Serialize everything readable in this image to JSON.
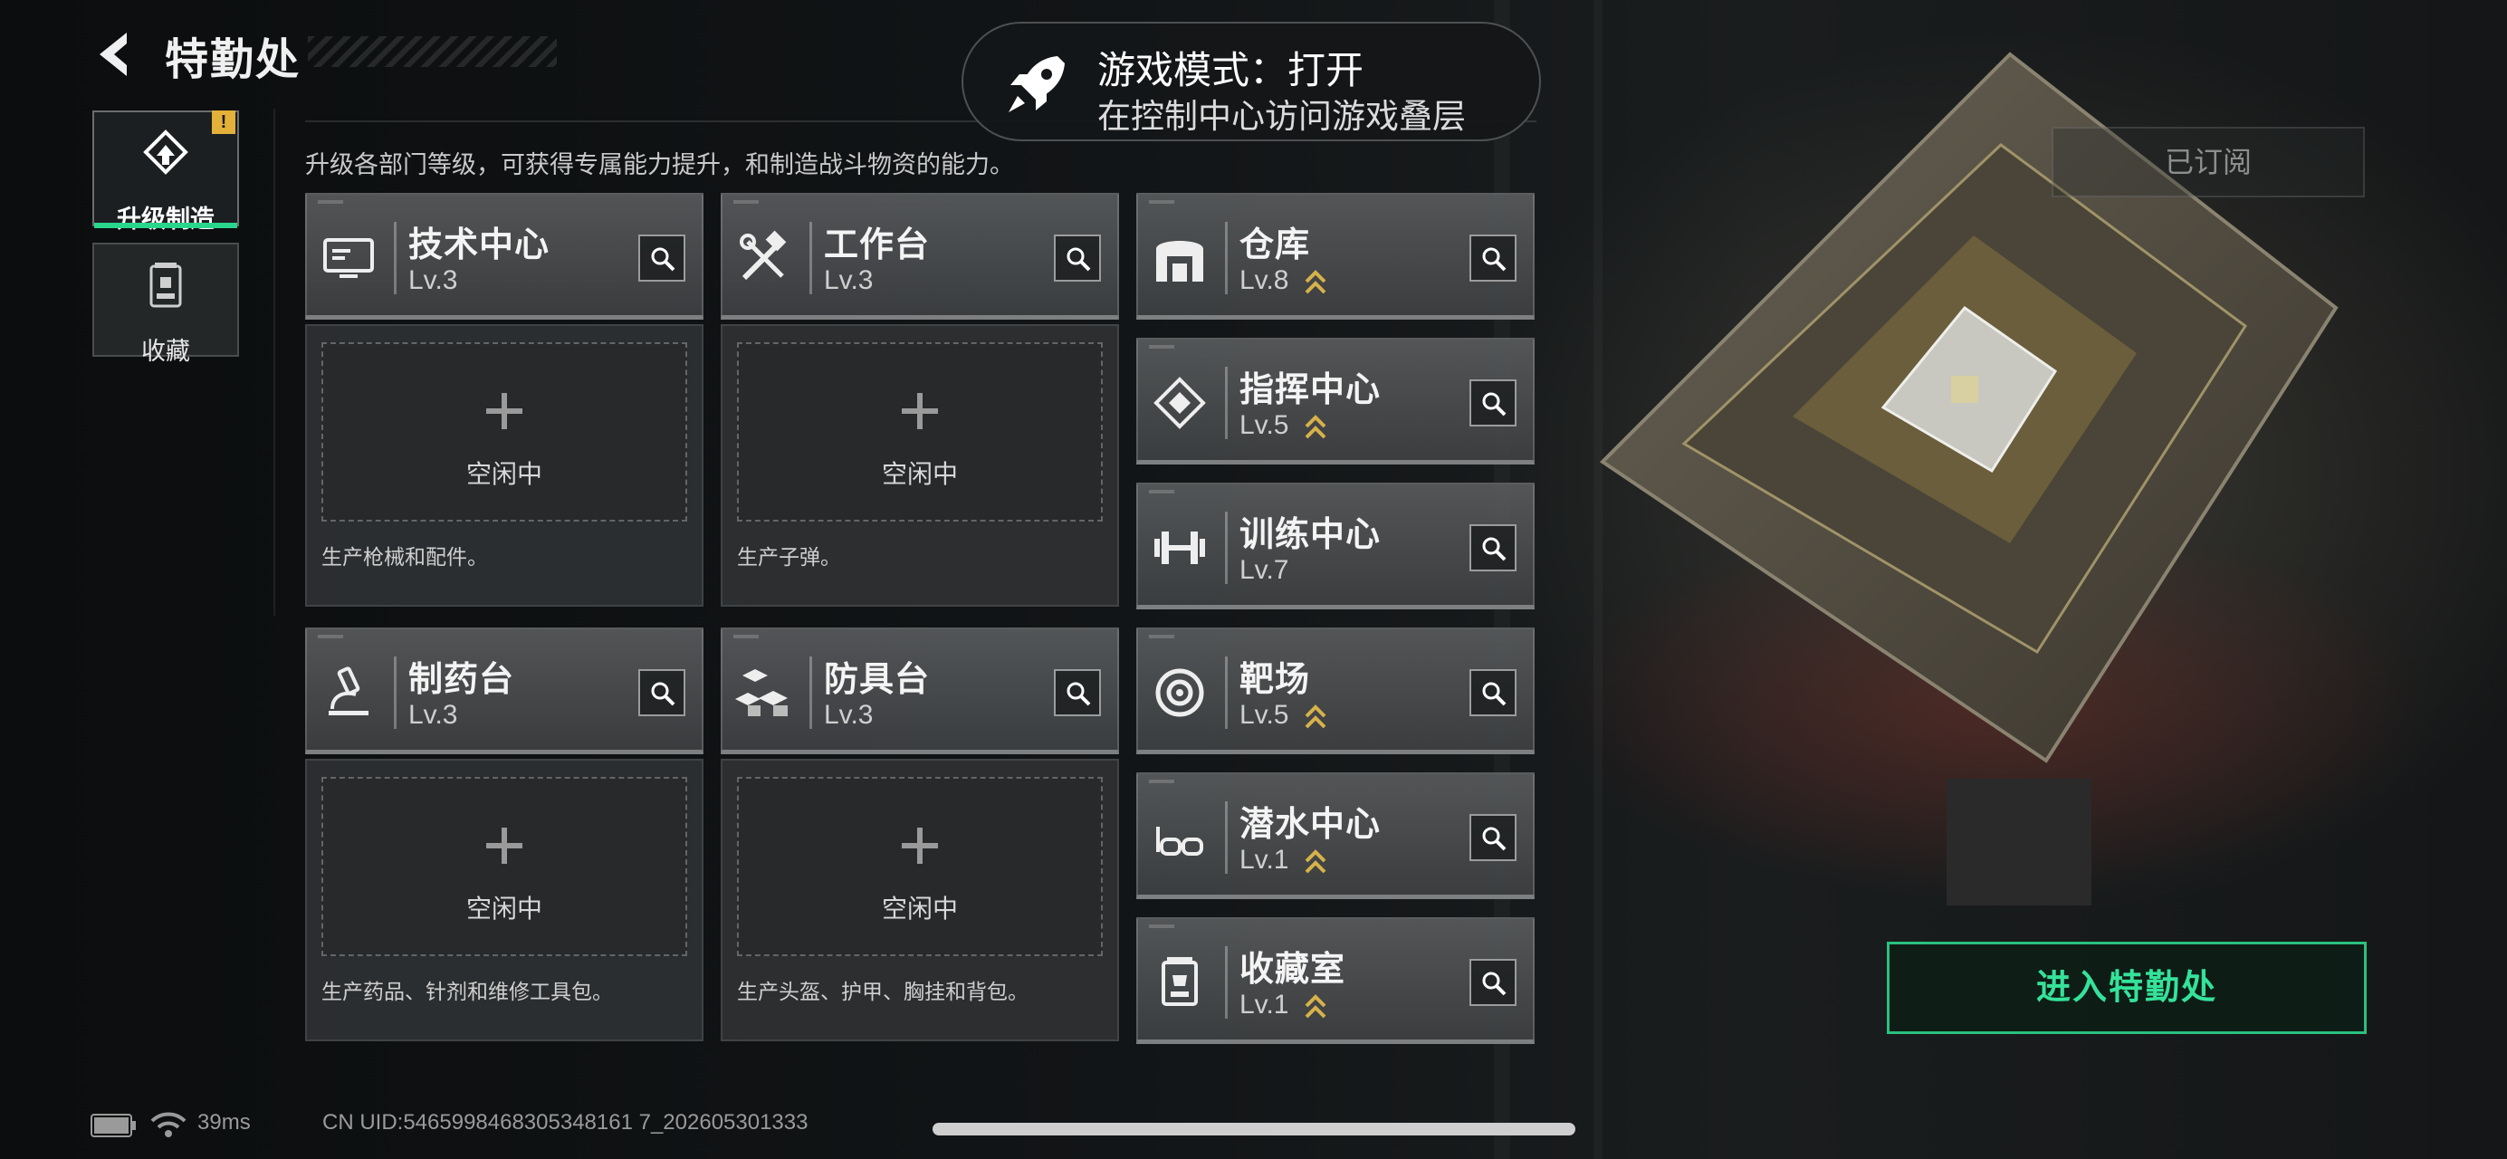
{
  "header": {
    "title": "特勤处"
  },
  "subtitle": "升级各部门等级，可获得专属能力提升，和制造战斗物资的能力。",
  "sidebar": {
    "items": [
      {
        "label": "升级制造",
        "active": true,
        "badge": "!"
      },
      {
        "label": "收藏",
        "active": false
      }
    ]
  },
  "toast": {
    "title": "游戏模式：打开",
    "subtitle": "在控制中心访问游戏叠层",
    "icon": "rocket-icon"
  },
  "production": [
    {
      "name": "技术中心",
      "level": "Lv.3",
      "icon": "computer-icon",
      "status": "空闲中",
      "desc": "生产枪械和配件。"
    },
    {
      "name": "工作台",
      "level": "Lv.3",
      "icon": "tools-icon",
      "status": "空闲中",
      "desc": "生产子弹。"
    },
    {
      "name": "制药台",
      "level": "Lv.3",
      "icon": "microscope-icon",
      "status": "空闲中",
      "desc": "生产药品、针剂和维修工具包。"
    },
    {
      "name": "防具台",
      "level": "Lv.3",
      "icon": "cubes-icon",
      "status": "空闲中",
      "desc": "生产头盔、护甲、胸挂和背包。"
    }
  ],
  "facilities": [
    {
      "name": "仓库",
      "level": "Lv.8",
      "upgradable": true,
      "icon": "warehouse-icon"
    },
    {
      "name": "指挥中心",
      "level": "Lv.5",
      "upgradable": true,
      "icon": "command-icon"
    },
    {
      "name": "训练中心",
      "level": "Lv.7",
      "upgradable": false,
      "icon": "dumbbell-icon"
    },
    {
      "name": "靶场",
      "level": "Lv.5",
      "upgradable": true,
      "icon": "target-icon"
    },
    {
      "name": "潜水中心",
      "level": "Lv.1",
      "upgradable": true,
      "icon": "goggles-icon"
    },
    {
      "name": "收藏室",
      "level": "Lv.1",
      "upgradable": true,
      "icon": "trophy-icon"
    }
  ],
  "subscribed_label": "已订阅",
  "enter_button": "进入特勤处",
  "status": {
    "ping": "39ms",
    "uid": "CN UID:5465998468305348161 7_202605301333"
  },
  "colors": {
    "accent": "#2ad58c",
    "upgrade": "#d7b24a",
    "badge": "#e3b03a"
  }
}
